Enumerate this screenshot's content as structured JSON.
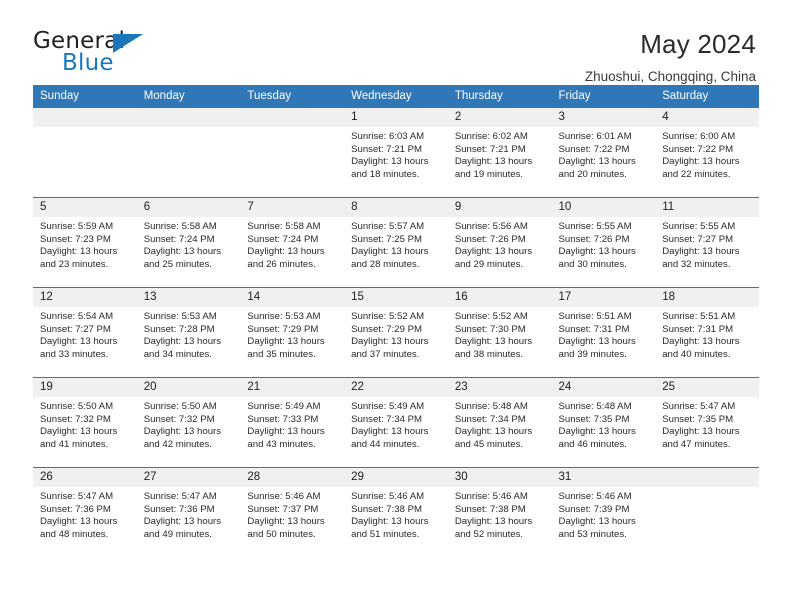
{
  "brand": {
    "name_part1": "General",
    "name_part2": "Blue",
    "triangle_color": "#1a75bb",
    "blue_color": "#1878be"
  },
  "header": {
    "title": "May 2024",
    "subtitle": "Zhuoshui, Chongqing, China"
  },
  "theme": {
    "header_blue": "#3077b8",
    "daynum_gray": "#f0f0f0"
  },
  "weekday_headers": [
    "Sunday",
    "Monday",
    "Tuesday",
    "Wednesday",
    "Thursday",
    "Friday",
    "Saturday"
  ],
  "weeks": [
    [
      {
        "day": "",
        "lines": []
      },
      {
        "day": "",
        "lines": []
      },
      {
        "day": "",
        "lines": []
      },
      {
        "day": "1",
        "lines": [
          "Sunrise: 6:03 AM",
          "Sunset: 7:21 PM",
          "Daylight: 13 hours",
          "and 18 minutes."
        ]
      },
      {
        "day": "2",
        "lines": [
          "Sunrise: 6:02 AM",
          "Sunset: 7:21 PM",
          "Daylight: 13 hours",
          "and 19 minutes."
        ]
      },
      {
        "day": "3",
        "lines": [
          "Sunrise: 6:01 AM",
          "Sunset: 7:22 PM",
          "Daylight: 13 hours",
          "and 20 minutes."
        ]
      },
      {
        "day": "4",
        "lines": [
          "Sunrise: 6:00 AM",
          "Sunset: 7:22 PM",
          "Daylight: 13 hours",
          "and 22 minutes."
        ]
      }
    ],
    [
      {
        "day": "5",
        "lines": [
          "Sunrise: 5:59 AM",
          "Sunset: 7:23 PM",
          "Daylight: 13 hours",
          "and 23 minutes."
        ]
      },
      {
        "day": "6",
        "lines": [
          "Sunrise: 5:58 AM",
          "Sunset: 7:24 PM",
          "Daylight: 13 hours",
          "and 25 minutes."
        ]
      },
      {
        "day": "7",
        "lines": [
          "Sunrise: 5:58 AM",
          "Sunset: 7:24 PM",
          "Daylight: 13 hours",
          "and 26 minutes."
        ]
      },
      {
        "day": "8",
        "lines": [
          "Sunrise: 5:57 AM",
          "Sunset: 7:25 PM",
          "Daylight: 13 hours",
          "and 28 minutes."
        ]
      },
      {
        "day": "9",
        "lines": [
          "Sunrise: 5:56 AM",
          "Sunset: 7:26 PM",
          "Daylight: 13 hours",
          "and 29 minutes."
        ]
      },
      {
        "day": "10",
        "lines": [
          "Sunrise: 5:55 AM",
          "Sunset: 7:26 PM",
          "Daylight: 13 hours",
          "and 30 minutes."
        ]
      },
      {
        "day": "11",
        "lines": [
          "Sunrise: 5:55 AM",
          "Sunset: 7:27 PM",
          "Daylight: 13 hours",
          "and 32 minutes."
        ]
      }
    ],
    [
      {
        "day": "12",
        "lines": [
          "Sunrise: 5:54 AM",
          "Sunset: 7:27 PM",
          "Daylight: 13 hours",
          "and 33 minutes."
        ]
      },
      {
        "day": "13",
        "lines": [
          "Sunrise: 5:53 AM",
          "Sunset: 7:28 PM",
          "Daylight: 13 hours",
          "and 34 minutes."
        ]
      },
      {
        "day": "14",
        "lines": [
          "Sunrise: 5:53 AM",
          "Sunset: 7:29 PM",
          "Daylight: 13 hours",
          "and 35 minutes."
        ]
      },
      {
        "day": "15",
        "lines": [
          "Sunrise: 5:52 AM",
          "Sunset: 7:29 PM",
          "Daylight: 13 hours",
          "and 37 minutes."
        ]
      },
      {
        "day": "16",
        "lines": [
          "Sunrise: 5:52 AM",
          "Sunset: 7:30 PM",
          "Daylight: 13 hours",
          "and 38 minutes."
        ]
      },
      {
        "day": "17",
        "lines": [
          "Sunrise: 5:51 AM",
          "Sunset: 7:31 PM",
          "Daylight: 13 hours",
          "and 39 minutes."
        ]
      },
      {
        "day": "18",
        "lines": [
          "Sunrise: 5:51 AM",
          "Sunset: 7:31 PM",
          "Daylight: 13 hours",
          "and 40 minutes."
        ]
      }
    ],
    [
      {
        "day": "19",
        "lines": [
          "Sunrise: 5:50 AM",
          "Sunset: 7:32 PM",
          "Daylight: 13 hours",
          "and 41 minutes."
        ]
      },
      {
        "day": "20",
        "lines": [
          "Sunrise: 5:50 AM",
          "Sunset: 7:32 PM",
          "Daylight: 13 hours",
          "and 42 minutes."
        ]
      },
      {
        "day": "21",
        "lines": [
          "Sunrise: 5:49 AM",
          "Sunset: 7:33 PM",
          "Daylight: 13 hours",
          "and 43 minutes."
        ]
      },
      {
        "day": "22",
        "lines": [
          "Sunrise: 5:49 AM",
          "Sunset: 7:34 PM",
          "Daylight: 13 hours",
          "and 44 minutes."
        ]
      },
      {
        "day": "23",
        "lines": [
          "Sunrise: 5:48 AM",
          "Sunset: 7:34 PM",
          "Daylight: 13 hours",
          "and 45 minutes."
        ]
      },
      {
        "day": "24",
        "lines": [
          "Sunrise: 5:48 AM",
          "Sunset: 7:35 PM",
          "Daylight: 13 hours",
          "and 46 minutes."
        ]
      },
      {
        "day": "25",
        "lines": [
          "Sunrise: 5:47 AM",
          "Sunset: 7:35 PM",
          "Daylight: 13 hours",
          "and 47 minutes."
        ]
      }
    ],
    [
      {
        "day": "26",
        "lines": [
          "Sunrise: 5:47 AM",
          "Sunset: 7:36 PM",
          "Daylight: 13 hours",
          "and 48 minutes."
        ]
      },
      {
        "day": "27",
        "lines": [
          "Sunrise: 5:47 AM",
          "Sunset: 7:36 PM",
          "Daylight: 13 hours",
          "and 49 minutes."
        ]
      },
      {
        "day": "28",
        "lines": [
          "Sunrise: 5:46 AM",
          "Sunset: 7:37 PM",
          "Daylight: 13 hours",
          "and 50 minutes."
        ]
      },
      {
        "day": "29",
        "lines": [
          "Sunrise: 5:46 AM",
          "Sunset: 7:38 PM",
          "Daylight: 13 hours",
          "and 51 minutes."
        ]
      },
      {
        "day": "30",
        "lines": [
          "Sunrise: 5:46 AM",
          "Sunset: 7:38 PM",
          "Daylight: 13 hours",
          "and 52 minutes."
        ]
      },
      {
        "day": "31",
        "lines": [
          "Sunrise: 5:46 AM",
          "Sunset: 7:39 PM",
          "Daylight: 13 hours",
          "and 53 minutes."
        ]
      },
      {
        "day": "",
        "lines": []
      }
    ]
  ]
}
